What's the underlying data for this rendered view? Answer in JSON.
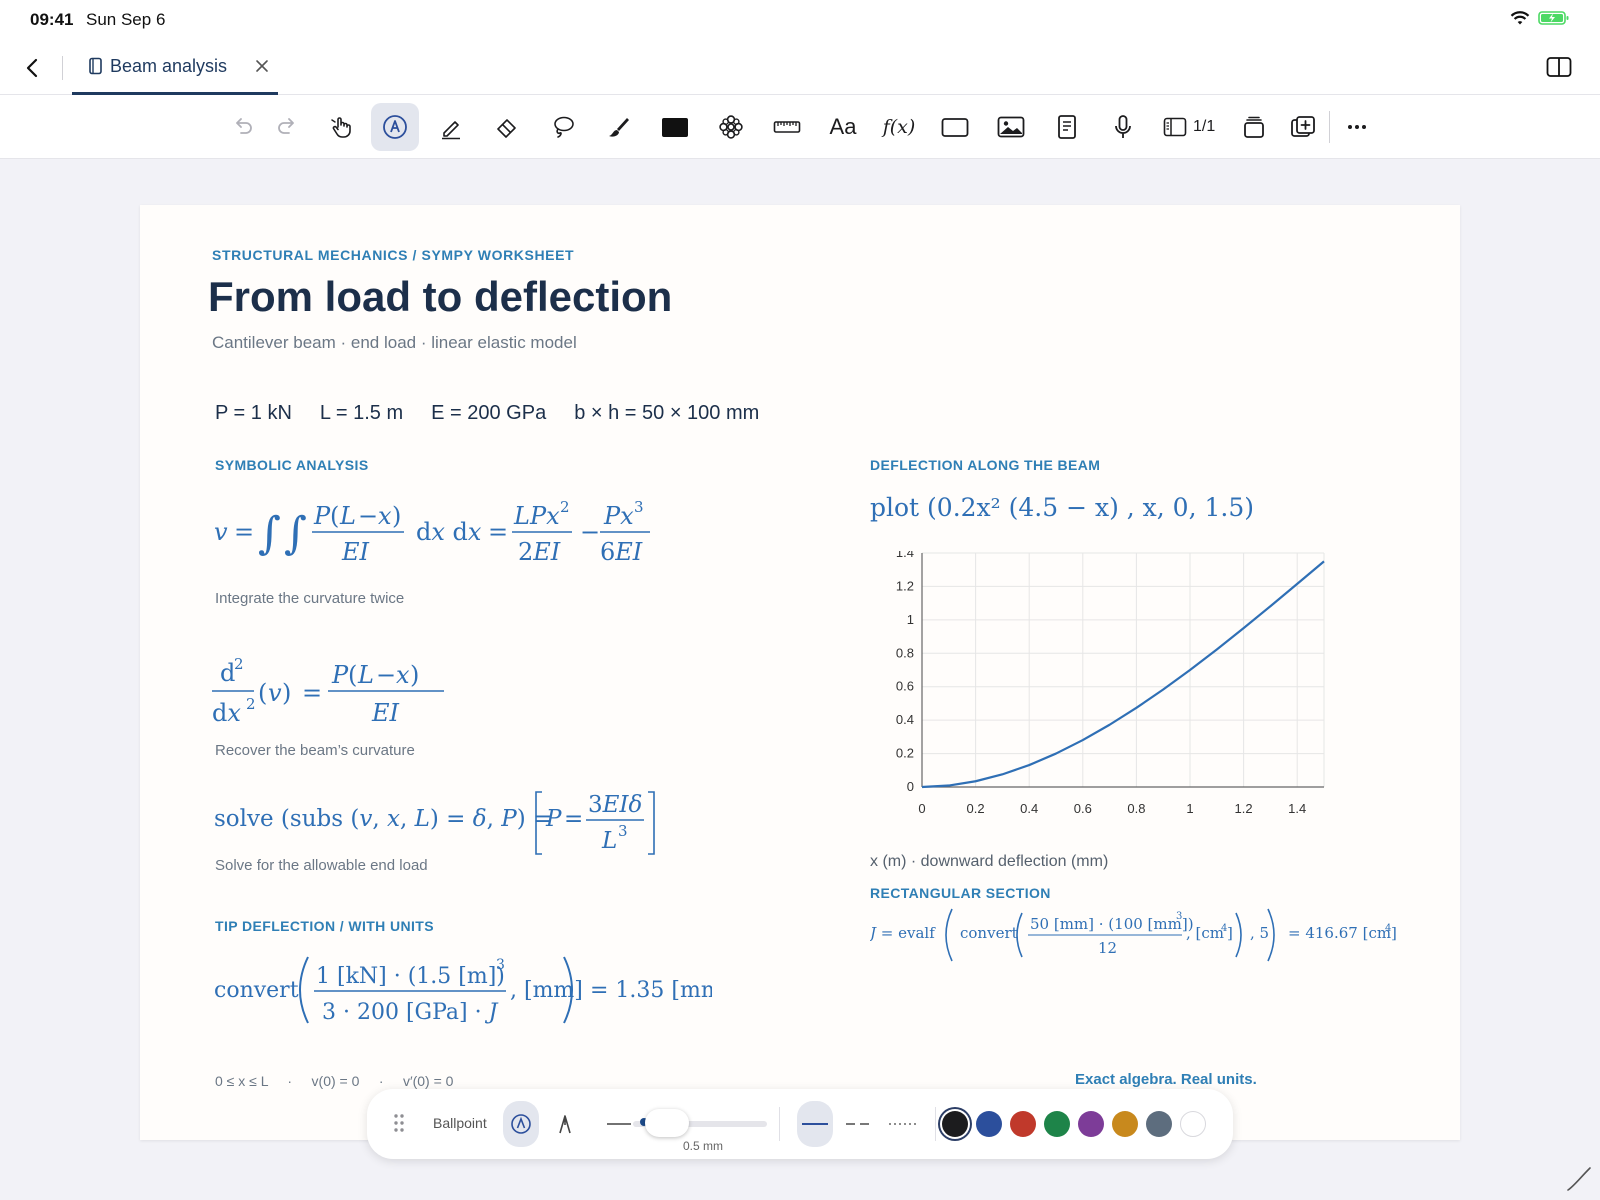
{
  "status": {
    "time": "09:41",
    "date": "Sun Sep 6"
  },
  "tab": {
    "title": "Beam analysis"
  },
  "toolbar": {
    "page_count": "1/1",
    "text_tool": "Aa",
    "formula_tool": "f(x)"
  },
  "page": {
    "breadcrumb": "STRUCTURAL MECHANICS  /  SYMPY WORKSHEET",
    "title": "From load to deflection",
    "subtitle": "Cantilever beam · end load · linear elastic model",
    "params": [
      "P = 1 kN",
      "L = 1.5 m",
      "E = 200 GPa",
      "b × h = 50 × 100 mm"
    ],
    "symbolic_label": "SYMBOLIC ANALYSIS",
    "captions": {
      "integrate": "Integrate the curvature twice",
      "curvature": "Recover the beam’s curvature",
      "solve": "Solve for the allowable end load"
    },
    "tip_label": "TIP DEFLECTION  /  WITH UNITS",
    "deflection_label": "DEFLECTION ALONG THE BEAM",
    "plot_cmd": "plot (0.2x² (4.5 − x) , x, 0, 1.5)",
    "chart_caption": "x (m) · downward deflection (mm)",
    "section_label": "RECTANGULAR SECTION",
    "footer_left": "0 ≤ x ≤ L     ·     v(0) = 0     ·     v′(0) = 0",
    "footer_right": "Exact algebra. Real units."
  },
  "chart_data": {
    "type": "line",
    "title": "",
    "xlabel": "x (m)",
    "ylabel": "downward deflection (mm)",
    "xlim": [
      0,
      1.5
    ],
    "ylim": [
      0,
      1.4
    ],
    "x_ticks": [
      0,
      0.2,
      0.4,
      0.6,
      0.8,
      1,
      1.2,
      1.4
    ],
    "y_ticks": [
      0,
      0.2,
      0.4,
      0.6,
      0.8,
      1,
      1.2,
      1.4
    ],
    "grid": true,
    "series": [
      {
        "color": "#2f6fb5",
        "x": [
          0,
          0.1,
          0.2,
          0.3,
          0.4,
          0.5,
          0.6,
          0.7,
          0.8,
          0.9,
          1.0,
          1.1,
          1.2,
          1.3,
          1.4,
          1.5
        ],
        "y": [
          0,
          0.0088,
          0.0344,
          0.0756,
          0.1312,
          0.2,
          0.2808,
          0.3724,
          0.4736,
          0.5832,
          0.7,
          0.8228,
          0.9504,
          1.0816,
          1.2152,
          1.35
        ]
      }
    ]
  },
  "palette": {
    "pen_name": "Ballpoint",
    "thickness": "0.5 mm",
    "thickness_value_mm": 0.5,
    "colors": [
      "#1c1c1e",
      "#2c4f9c",
      "#c0392b",
      "#1e8449",
      "#7d3c98",
      "#c8891d",
      "#5d6d7e",
      "#ffffff"
    ],
    "selected_color": "#1c1c1e"
  }
}
